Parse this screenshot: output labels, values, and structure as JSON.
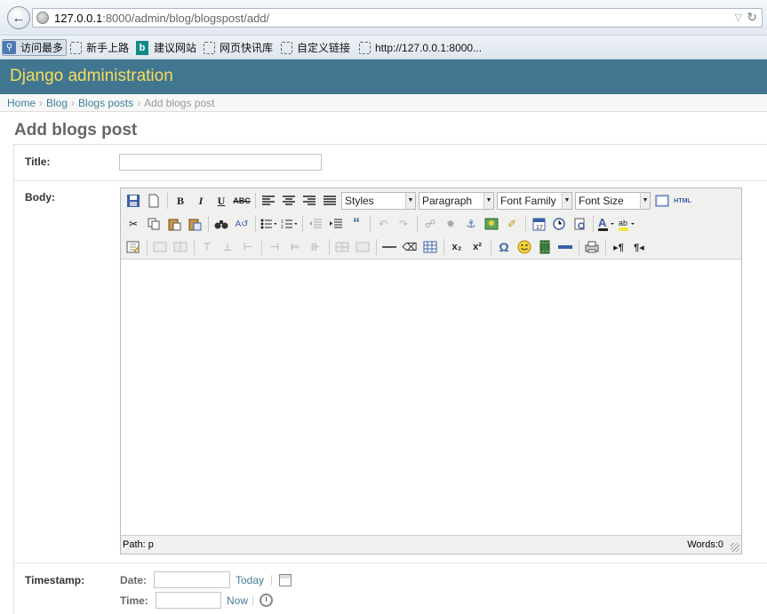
{
  "browser": {
    "url_host": "127.0.0.1",
    "url_rest": ":8000/admin/blog/blogspost/add/",
    "bookmarks": [
      "访问最多",
      "新手上路",
      "建议网站",
      "网页快讯库",
      "自定义链接",
      "http://127.0.0.1:8000..."
    ]
  },
  "header": {
    "title": "Django administration"
  },
  "breadcrumbs": {
    "home": "Home",
    "app": "Blog",
    "model": "Blogs posts",
    "current": "Add blogs post",
    "separator": "›"
  },
  "page": {
    "title": "Add blogs post"
  },
  "form": {
    "title_label": "Title:",
    "title_value": "",
    "body_label": "Body:",
    "timestamp_label": "Timestamp:",
    "date_label": "Date:",
    "date_value": "",
    "today_link": "Today",
    "time_label": "Time:",
    "time_value": "",
    "now_link": "Now"
  },
  "editor": {
    "selects": {
      "styles": "Styles",
      "format": "Paragraph",
      "font_family": "Font Family",
      "font_size": "Font Size"
    },
    "html_button": "HTML",
    "status_path": "Path: p",
    "status_words": "Words:0"
  }
}
